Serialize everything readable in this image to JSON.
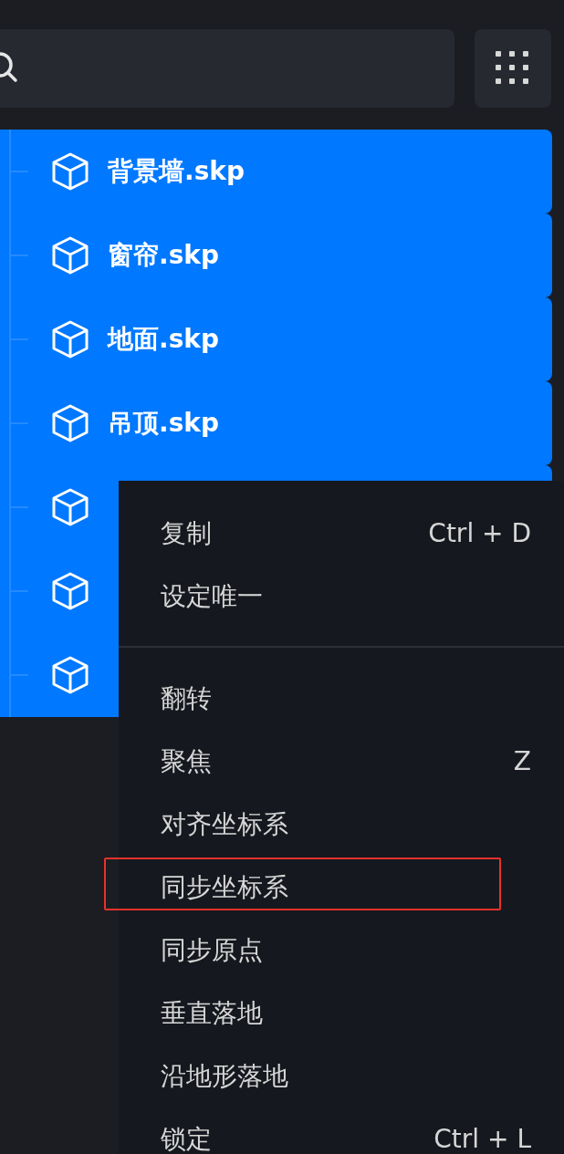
{
  "tree": {
    "items": [
      {
        "label": "背景墙.skp",
        "selected": true
      },
      {
        "label": "窗帘.skp",
        "selected": true
      },
      {
        "label": "地面.skp",
        "selected": true
      },
      {
        "label": "吊顶.skp",
        "selected": true
      },
      {
        "selected": true
      },
      {
        "selected": true
      },
      {
        "selected": true
      }
    ]
  },
  "context_menu": {
    "items": [
      {
        "kind": "action",
        "label": "复制",
        "shortcut": "Ctrl + D",
        "highlighted": false
      },
      {
        "kind": "action",
        "label": "设定唯一",
        "highlighted": false
      },
      {
        "kind": "divider"
      },
      {
        "kind": "action",
        "label": "翻转",
        "highlighted": false
      },
      {
        "kind": "action",
        "label": "聚焦",
        "shortcut": "Z",
        "highlighted": false
      },
      {
        "kind": "action",
        "label": "对齐坐标系",
        "highlighted": false
      },
      {
        "kind": "action",
        "label": "同步坐标系",
        "highlighted": true
      },
      {
        "kind": "action",
        "label": "同步原点",
        "highlighted": false
      },
      {
        "kind": "action",
        "label": "垂直落地",
        "highlighted": false
      },
      {
        "kind": "action",
        "label": "沿地形落地",
        "highlighted": false
      },
      {
        "kind": "action",
        "label": "锁定",
        "shortcut": "Ctrl + L",
        "highlighted": false
      }
    ]
  }
}
